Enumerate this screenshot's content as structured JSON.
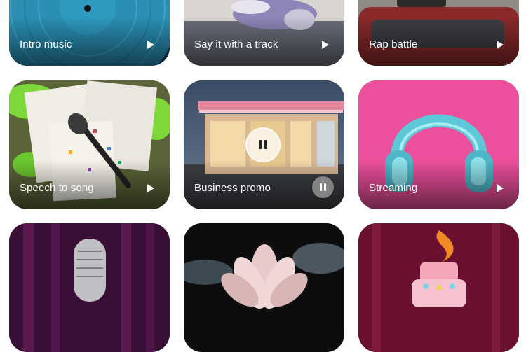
{
  "cards": [
    {
      "title": "Intro music",
      "control": "play"
    },
    {
      "title": "Say it with a track",
      "control": "play"
    },
    {
      "title": "Rap battle",
      "control": "play"
    },
    {
      "title": "Speech to song",
      "control": "play"
    },
    {
      "title": "Business promo",
      "control": "pause"
    },
    {
      "title": "Streaming",
      "control": "play"
    },
    {
      "title": "",
      "control": ""
    },
    {
      "title": "",
      "control": ""
    },
    {
      "title": "",
      "control": ""
    }
  ],
  "colors": {
    "vinyl": "#2a8fb3",
    "streaming_bg": "#ec4f9b",
    "headphones": "#5ec8d8",
    "speech_bg": "#4a6a3a",
    "feather": "#7fd83a",
    "promo_sky": "#2f3d52",
    "promo_neon": "#e48aa0",
    "mic_bg": "#4a1240",
    "lotus_bg": "#0d0d0f",
    "cake_bg": "#6a1030"
  }
}
